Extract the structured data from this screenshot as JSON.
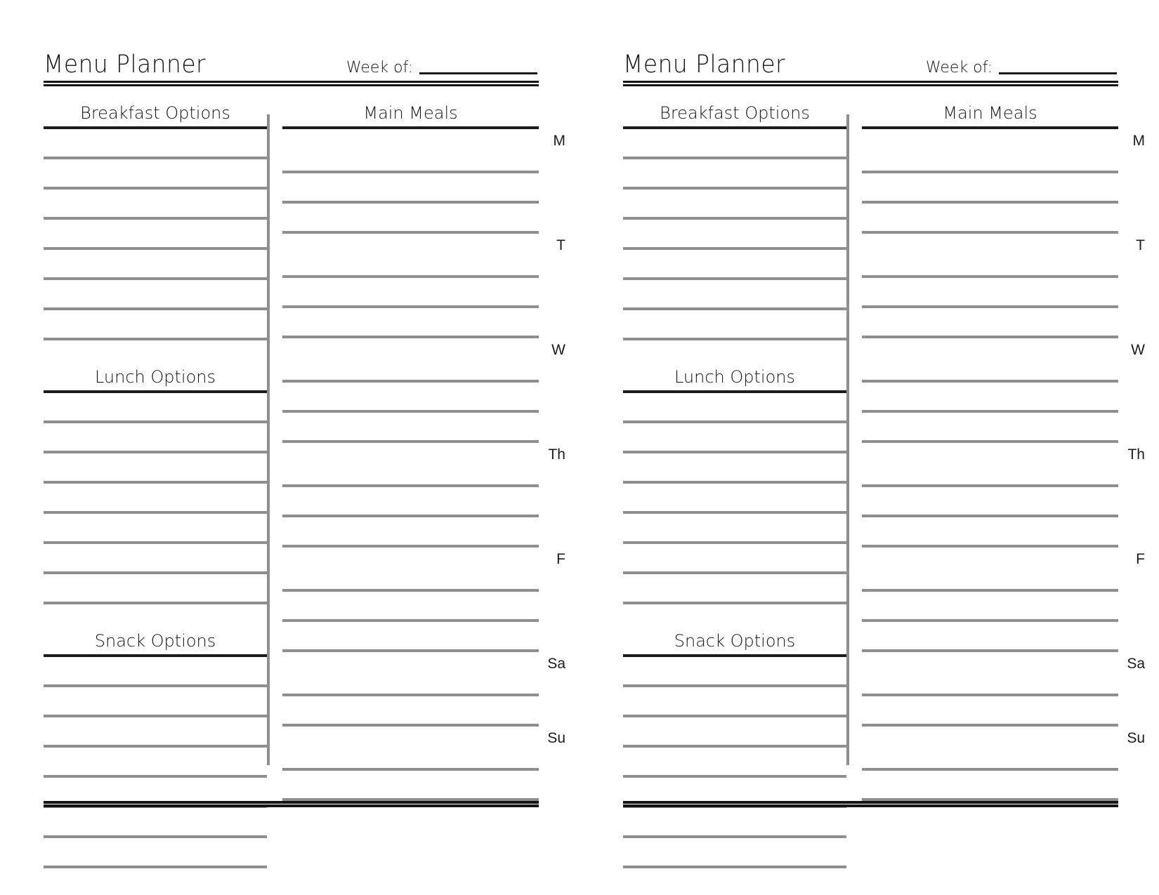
{
  "page": {
    "background": "#ffffff",
    "line_color": "#8f8f8f",
    "rule_color": "#151515"
  },
  "panels": [
    {
      "header": {
        "title": "Menu Planner",
        "week_of_label": "Week of:",
        "week_of_value": ""
      },
      "left_column": {
        "sections": [
          {
            "heading": "Breakfast Options",
            "line_count": 7
          },
          {
            "heading": "Lunch Options",
            "line_count": 7
          },
          {
            "heading": "Snack Options",
            "line_count": 7
          }
        ]
      },
      "right_column": {
        "heading": "Main Meals",
        "days": [
          {
            "label": "M",
            "line_count": 3
          },
          {
            "label": "T",
            "line_count": 3
          },
          {
            "label": "W",
            "line_count": 3
          },
          {
            "label": "Th",
            "line_count": 3
          },
          {
            "label": "F",
            "line_count": 3
          },
          {
            "label": "Sa",
            "line_count": 2
          },
          {
            "label": "Su",
            "line_count": 2
          }
        ]
      }
    },
    {
      "header": {
        "title": "Menu Planner",
        "week_of_label": "Week of:",
        "week_of_value": ""
      },
      "left_column": {
        "sections": [
          {
            "heading": "Breakfast Options",
            "line_count": 7
          },
          {
            "heading": "Lunch Options",
            "line_count": 7
          },
          {
            "heading": "Snack Options",
            "line_count": 7
          }
        ]
      },
      "right_column": {
        "heading": "Main Meals",
        "days": [
          {
            "label": "M",
            "line_count": 3
          },
          {
            "label": "T",
            "line_count": 3
          },
          {
            "label": "W",
            "line_count": 3
          },
          {
            "label": "Th",
            "line_count": 3
          },
          {
            "label": "F",
            "line_count": 3
          },
          {
            "label": "Sa",
            "line_count": 2
          },
          {
            "label": "Su",
            "line_count": 2
          }
        ]
      }
    }
  ]
}
